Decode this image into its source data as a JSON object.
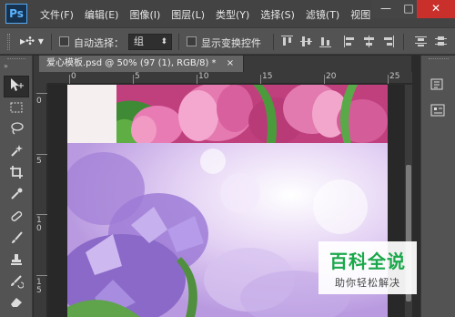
{
  "app": {
    "logo": "Ps"
  },
  "menu": [
    "文件(F)",
    "编辑(E)",
    "图像(I)",
    "图层(L)",
    "类型(Y)",
    "选择(S)",
    "滤镜(T)",
    "视图"
  ],
  "window_controls": {
    "minimize": "—",
    "maximize": "□",
    "close": "✕"
  },
  "options": {
    "move_tool": "▸✣ ▾",
    "auto_select_label": "自动选择：",
    "auto_select_checked": false,
    "auto_select_value": "组",
    "show_transform_label": "显示变换控件",
    "show_transform_checked": false
  },
  "document": {
    "tab_title": "爱心模板.psd @ 50% (97 (1), RGB/8) *",
    "close": "×"
  },
  "ruler": {
    "top": [
      "0",
      "5",
      "10",
      "15",
      "20",
      "25"
    ],
    "left": [
      "0",
      "5",
      "1\n0",
      "1\n5"
    ]
  },
  "tools": [
    "move-tool",
    "marquee-tool",
    "lasso-tool",
    "quick-select-tool",
    "crop-tool",
    "eyedropper-tool",
    "healing-brush-tool",
    "brush-tool",
    "clone-stamp-tool",
    "history-brush-tool",
    "eraser-tool"
  ],
  "right_panel": [
    "panel-toggle-icon",
    "history-icon",
    "properties-icon"
  ],
  "watermark": {
    "title": "百科全说",
    "subtitle": "助你轻松解决"
  },
  "colors": {
    "menubar": "#434343",
    "panel": "#535353",
    "close_button": "#c9302c",
    "watermark_green": "#1aa84a"
  }
}
